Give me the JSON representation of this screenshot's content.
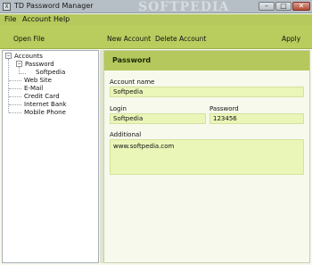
{
  "window": {
    "title": "TD Password Manager",
    "watermark": "SOFTPEDIA",
    "app_icon": "td-app-icon",
    "controls": {
      "minimize": "–",
      "maximize": "□",
      "close": "✕"
    }
  },
  "menu": {
    "items": [
      "File",
      "Account",
      "Help"
    ]
  },
  "toolbar": {
    "open_file": "Open File",
    "new_account": "New Account",
    "delete_account": "Delete Account",
    "apply": "Apply"
  },
  "tree": {
    "root": "Accounts",
    "expander_open": "−",
    "selected_group": "Password",
    "selected_child": "Softpedia",
    "groups": [
      "Web Site",
      "E-Mail",
      "Credit Card",
      "Internet Bank",
      "Mobile Phone"
    ]
  },
  "details": {
    "header": "Password",
    "account_name_label": "Account name",
    "account_name_value": "Softpedia",
    "login_label": "Login",
    "login_value": "Softpedia",
    "password_label": "Password",
    "password_value": "123456",
    "additional_label": "Additional",
    "additional_value": "www.softpedia.com"
  },
  "colors": {
    "accent": "#b8cd5e",
    "field_bg": "#eaf5b8",
    "panel_bg": "#f6f9ec",
    "titlebar": "#b7bfc6",
    "close_button": "#b54a35"
  }
}
